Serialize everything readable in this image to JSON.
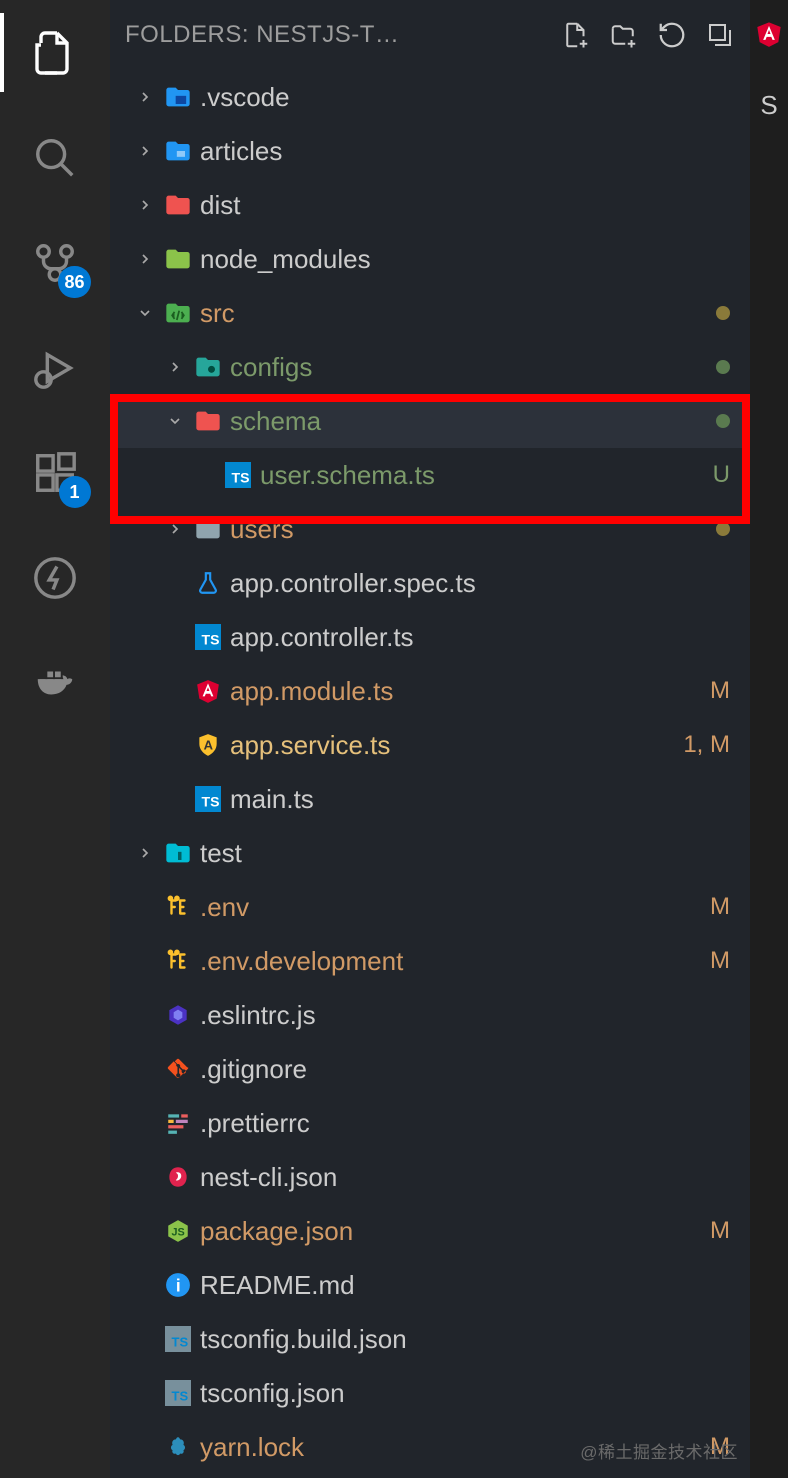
{
  "header": {
    "title": "FOLDERS: NESTJS-T…"
  },
  "activityBadges": {
    "scm": "86",
    "extensions": "1"
  },
  "tree": [
    {
      "depth": 0,
      "arrow": "right",
      "icon": "folder-blue-vs",
      "label": ".vscode"
    },
    {
      "depth": 0,
      "arrow": "right",
      "icon": "folder-blue",
      "label": "articles"
    },
    {
      "depth": 0,
      "arrow": "right",
      "icon": "folder-red",
      "label": "dist"
    },
    {
      "depth": 0,
      "arrow": "right",
      "icon": "folder-green-lt",
      "label": "node_modules"
    },
    {
      "depth": 0,
      "arrow": "down",
      "icon": "folder-src",
      "label": "src",
      "labelClass": "c-oran",
      "dot": "dot-olv"
    },
    {
      "depth": 1,
      "arrow": "right",
      "icon": "folder-cfg",
      "label": "configs",
      "labelClass": "c-green",
      "dot": "dot-grn"
    },
    {
      "depth": 1,
      "arrow": "down",
      "icon": "folder-red",
      "label": "schema",
      "labelClass": "c-green",
      "dot": "dot-grn",
      "selected": true
    },
    {
      "depth": 2,
      "arrow": "",
      "icon": "ts",
      "label": "user.schema.ts",
      "labelClass": "c-green",
      "statusText": "U",
      "statusClass": "st-u"
    },
    {
      "depth": 1,
      "arrow": "right",
      "icon": "folder-gray",
      "label": "users",
      "labelClass": "c-oran",
      "dot": "dot-olv"
    },
    {
      "depth": 1,
      "arrow": "",
      "icon": "flask",
      "label": "app.controller.spec.ts"
    },
    {
      "depth": 1,
      "arrow": "",
      "icon": "ts",
      "label": "app.controller.ts"
    },
    {
      "depth": 1,
      "arrow": "",
      "icon": "angular",
      "label": "app.module.ts",
      "labelClass": "c-oran",
      "statusText": "M",
      "statusClass": "st-m"
    },
    {
      "depth": 1,
      "arrow": "",
      "icon": "shield-a",
      "label": "app.service.ts",
      "labelClass": "c-yel",
      "statusText": "1, M",
      "statusClass": "st-m"
    },
    {
      "depth": 1,
      "arrow": "",
      "icon": "ts",
      "label": "main.ts"
    },
    {
      "depth": 0,
      "arrow": "right",
      "icon": "folder-test",
      "label": "test"
    },
    {
      "depth": 0,
      "arrow": "",
      "icon": "env",
      "label": ".env",
      "labelClass": "c-oran",
      "statusText": "M",
      "statusClass": "st-m"
    },
    {
      "depth": 0,
      "arrow": "",
      "icon": "env",
      "label": ".env.development",
      "labelClass": "c-oran",
      "statusText": "M",
      "statusClass": "st-m"
    },
    {
      "depth": 0,
      "arrow": "",
      "icon": "eslint",
      "label": ".eslintrc.js"
    },
    {
      "depth": 0,
      "arrow": "",
      "icon": "git",
      "label": ".gitignore"
    },
    {
      "depth": 0,
      "arrow": "",
      "icon": "prettier",
      "label": ".prettierrc"
    },
    {
      "depth": 0,
      "arrow": "",
      "icon": "nest",
      "label": "nest-cli.json"
    },
    {
      "depth": 0,
      "arrow": "",
      "icon": "node",
      "label": "package.json",
      "labelClass": "c-oran",
      "statusText": "M",
      "statusClass": "st-m"
    },
    {
      "depth": 0,
      "arrow": "",
      "icon": "info",
      "label": "README.md"
    },
    {
      "depth": 0,
      "arrow": "",
      "icon": "tsconf",
      "label": "tsconfig.build.json"
    },
    {
      "depth": 0,
      "arrow": "",
      "icon": "tsconf",
      "label": "tsconfig.json"
    },
    {
      "depth": 0,
      "arrow": "",
      "icon": "yarn",
      "label": "yarn.lock",
      "labelClass": "c-oran",
      "statusText": "M",
      "statusClass": "st-m"
    }
  ],
  "rightStrip": {
    "topChar": "S"
  },
  "watermark": "@稀土掘金技术社区"
}
